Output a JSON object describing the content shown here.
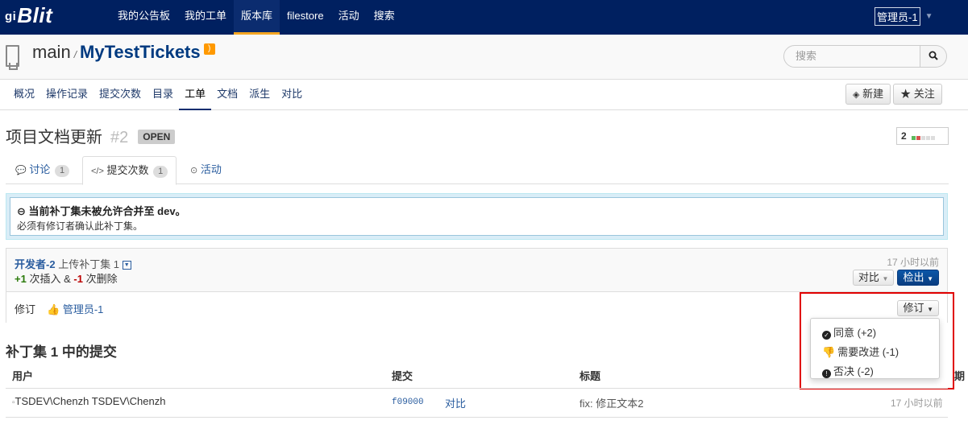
{
  "navbar": {
    "brand_prefix": "gi",
    "brand": "Blit",
    "items": [
      {
        "label": "我的公告板",
        "active": false
      },
      {
        "label": "我的工单",
        "active": false
      },
      {
        "label": "版本库",
        "active": true
      },
      {
        "label": "filestore",
        "active": false
      },
      {
        "label": "活动",
        "active": false
      },
      {
        "label": "搜索",
        "active": false
      }
    ],
    "user_avatar_alt": "管理员-1"
  },
  "repo": {
    "path": "main",
    "name": "MyTestTickets",
    "search_placeholder": "搜索"
  },
  "subnav": {
    "items": [
      {
        "label": "概况",
        "active": false
      },
      {
        "label": "操作记录",
        "active": false
      },
      {
        "label": "提交次数",
        "active": false
      },
      {
        "label": "目录",
        "active": false
      },
      {
        "label": "工单",
        "active": true
      },
      {
        "label": "文档",
        "active": false
      },
      {
        "label": "派生",
        "active": false
      },
      {
        "label": "对比",
        "active": false
      }
    ],
    "new_button": "新建",
    "watch_button": "关注"
  },
  "ticket": {
    "title": "项目文档更新",
    "number": "#2",
    "status": "OPEN",
    "vote_count": "2",
    "colors": {
      "vote_green": "#5cb85c",
      "vote_red": "#d9534f",
      "vote_grey": "#dddddd"
    }
  },
  "tabs": [
    {
      "label": "讨论",
      "count": "1",
      "icon": "comments-icon"
    },
    {
      "label": "提交次数",
      "count": "1",
      "icon": "code-icon"
    },
    {
      "label": "活动",
      "count": "",
      "icon": "clock-icon"
    }
  ],
  "alert": {
    "title": "当前补丁集未被允许合并至 dev。",
    "subtitle": "必须有修订者确认此补丁集。"
  },
  "patchset": {
    "author": "开发者-2",
    "uploaded_text": "上传补丁集 1",
    "insertions": "+1",
    "insertions_label": "次插入 &",
    "deletions": "-1",
    "deletions_label": "次删除",
    "time": "17 小时以前",
    "compare_button": "对比",
    "checkout_button": "检出",
    "review_label": "修订",
    "reviewer": "管理员-1",
    "review_button": "修订"
  },
  "review_menu": {
    "items": [
      {
        "label": "同意 (+2)",
        "icon": "check-circle-icon"
      },
      {
        "label": "需要改进 (-1)",
        "icon": "thumbs-down-icon"
      },
      {
        "label": "否决 (-2)",
        "icon": "exclamation-circle-icon"
      }
    ]
  },
  "commits": {
    "title": "补丁集 1 中的提交",
    "headers": {
      "user": "用户",
      "commit": "提交",
      "subject": "标题",
      "date_partial": "期"
    },
    "rows": [
      {
        "avatar_alt": "TSDEV\\Chenzh",
        "user": "TSDEV\\Chenzh",
        "sha": "f09000",
        "compare": "对比",
        "subject_prefix": "fix:",
        "subject": "修正文本2",
        "time": "17 小时以前"
      }
    ]
  }
}
